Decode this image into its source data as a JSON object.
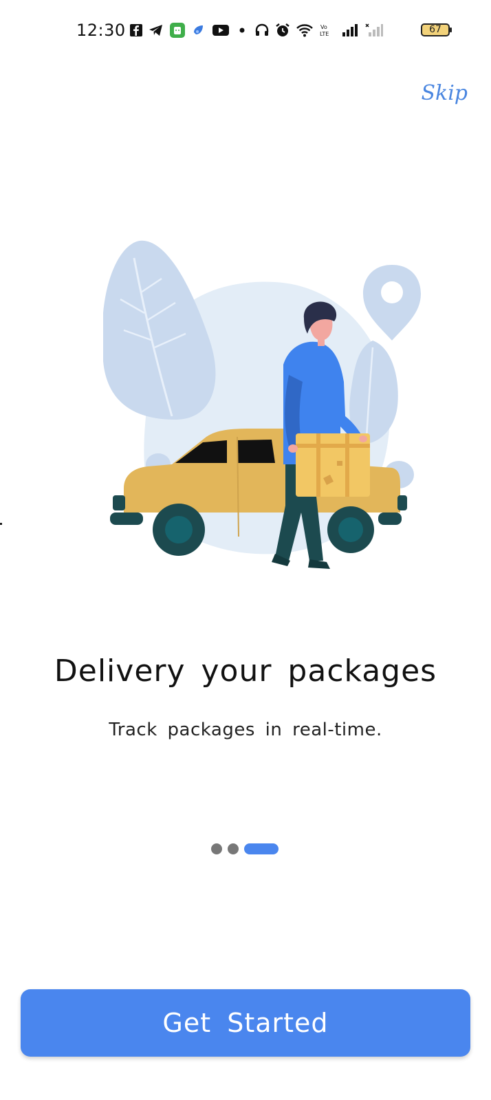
{
  "status_bar": {
    "time": "12:30",
    "battery": "67",
    "icons": [
      "facebook-icon",
      "telegram-icon",
      "android-app-icon",
      "app-icon",
      "youtube-icon",
      "dot-icon",
      "headphones-icon",
      "alarm-icon",
      "wifi-icon",
      "volte-icon",
      "signal-icon",
      "signal-2-icon",
      "battery-icon"
    ]
  },
  "header": {
    "skip_label": "Skip"
  },
  "content": {
    "title": "Delivery your packages",
    "subtitle": "Track packages in real-time."
  },
  "pager": {
    "total": 3,
    "active_index": 2
  },
  "footer": {
    "cta_label": "Get Started"
  },
  "colors": {
    "accent": "#4a86ee",
    "car": "#e2b65a",
    "box": "#f2c764",
    "shirt": "#3f83ee",
    "pants": "#1c4a4f",
    "bg_shape": "#e3edf7",
    "leaf": "#c9d9ee"
  }
}
